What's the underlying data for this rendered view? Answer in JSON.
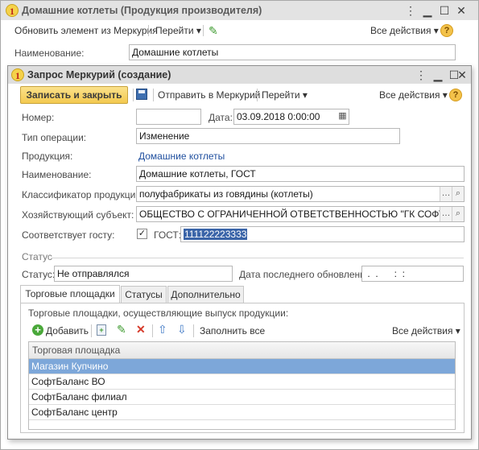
{
  "bg_window": {
    "title": "Домашние котлеты (Продукция производителя)",
    "toolbar": {
      "update_from_mercury": "Обновить элемент из Меркурия",
      "goto": "Перейти",
      "all_actions": "Все действия",
      "help": "?"
    },
    "name_label": "Наименование:",
    "name_value": "Домашние котлеты"
  },
  "window": {
    "title": "Запрос Меркурий (создание)",
    "toolbar": {
      "save_close": "Записать и закрыть",
      "send": "Отправить в Меркурий",
      "goto": "Перейти",
      "all_actions": "Все действия",
      "help": "?"
    },
    "form": {
      "number_label": "Номер:",
      "number_value": "",
      "date_label": "Дата:",
      "date_value": "03.09.2018  0:00:00",
      "op_type_label": "Тип операции:",
      "op_type_value": "Изменение",
      "product_label": "Продукция:",
      "product_value": "Домашние котлеты",
      "name_label": "Наименование:",
      "name_value": "Домашние котлеты, ГОСТ",
      "classifier_label": "Классификатор продукции:",
      "classifier_value": "полуфабрикаты из говядины (котлеты)",
      "entity_label": "Хозяйствующий субъект:",
      "entity_value": "ОБЩЕСТВО С ОГРАНИЧЕННОЙ ОТВЕТСТВЕННОСТЬЮ \"ГК СОФТБАЛАНС\"",
      "gost_label": "Соответствует госту:",
      "gost_checked": true,
      "gost_field_label": "ГОСТ:",
      "gost_value": "111122223333"
    },
    "status_section": {
      "title": "Статус",
      "status_label": "Статус:",
      "status_value": "Не отправлялся",
      "last_update_label": "Дата последнего обновления:",
      "last_update_value": " .  .      :  :"
    },
    "tabs": [
      {
        "label": "Торговые площадки",
        "active": true
      },
      {
        "label": "Статусы",
        "active": false
      },
      {
        "label": "Дополнительно",
        "active": false
      }
    ],
    "tab_content": {
      "caption": "Торговые площадки, осуществляющие выпуск продукции:",
      "toolbar": {
        "add": "Добавить",
        "fill_all": "Заполнить все",
        "all_actions": "Все действия"
      },
      "column_header": "Торговая площадка",
      "rows": [
        "Магазин Купчино",
        "СофтБаланс ВО",
        "СофтБаланс филиал",
        "СофтБаланс центр"
      ],
      "selected_row": 0
    }
  },
  "colors": {
    "accent_yellow": "#f3c94f",
    "link_blue": "#1e4e9e",
    "selection_blue": "#7da7d9"
  }
}
